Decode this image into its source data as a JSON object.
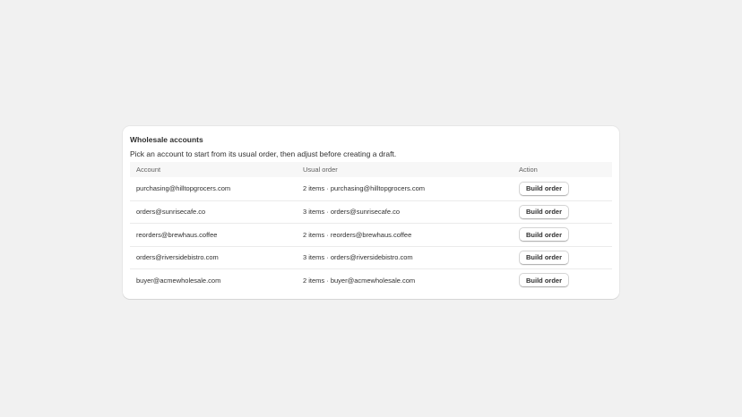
{
  "card": {
    "title": "Wholesale accounts",
    "description": "Pick an account to start from its usual order, then adjust before creating a draft."
  },
  "table": {
    "headers": {
      "account": "Account",
      "usual_order": "Usual order",
      "action": "Action"
    },
    "rows": [
      {
        "account": "purchasing@hilltopgrocers.com",
        "usual_order": "2 items · purchasing@hilltopgrocers.com",
        "action": "Build order"
      },
      {
        "account": "orders@sunrisecafe.co",
        "usual_order": "3 items · orders@sunrisecafe.co",
        "action": "Build order"
      },
      {
        "account": "reorders@brewhaus.coffee",
        "usual_order": "2 items · reorders@brewhaus.coffee",
        "action": "Build order"
      },
      {
        "account": "orders@riversidebistro.com",
        "usual_order": "3 items · orders@riversidebistro.com",
        "action": "Build order"
      },
      {
        "account": "buyer@acmewholesale.com",
        "usual_order": "2 items · buyer@acmewholesale.com",
        "action": "Build order"
      }
    ]
  }
}
